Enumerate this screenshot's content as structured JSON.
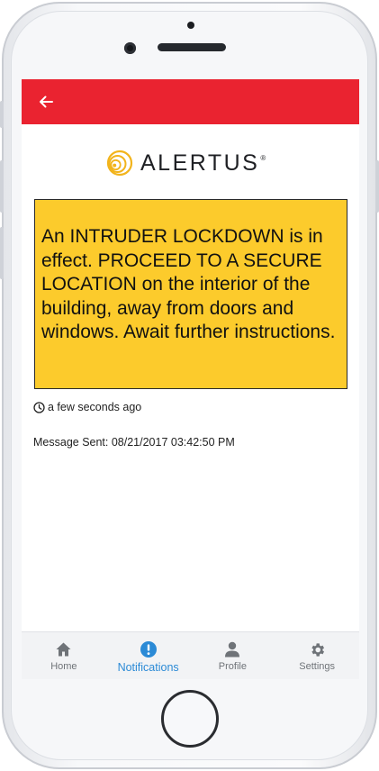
{
  "app": {
    "brand": "ALERTUS",
    "brand_mark": "®",
    "colors": {
      "appbar": "#ea2330",
      "alert_background": "#fccb2c",
      "active_tab": "#2b8ad6",
      "inactive_tab": "#6f7378"
    }
  },
  "header": {
    "back_icon": "arrow-left-icon"
  },
  "alert": {
    "message": "An INTRUDER LOCKDOWN is in effect. PROCEED TO A SECURE LOCATION on the interior of the building, away from doors and windows. Await further instructions.",
    "relative_time": "a few seconds ago",
    "sent_label": "Message Sent: 08/21/2017 03:42:50 PM"
  },
  "tabs": [
    {
      "label": "Home",
      "icon": "home-icon",
      "active": false
    },
    {
      "label": "Notifications",
      "icon": "alert-circle-icon",
      "active": true
    },
    {
      "label": "Profile",
      "icon": "person-icon",
      "active": false
    },
    {
      "label": "Settings",
      "icon": "gear-icon",
      "active": false
    }
  ]
}
